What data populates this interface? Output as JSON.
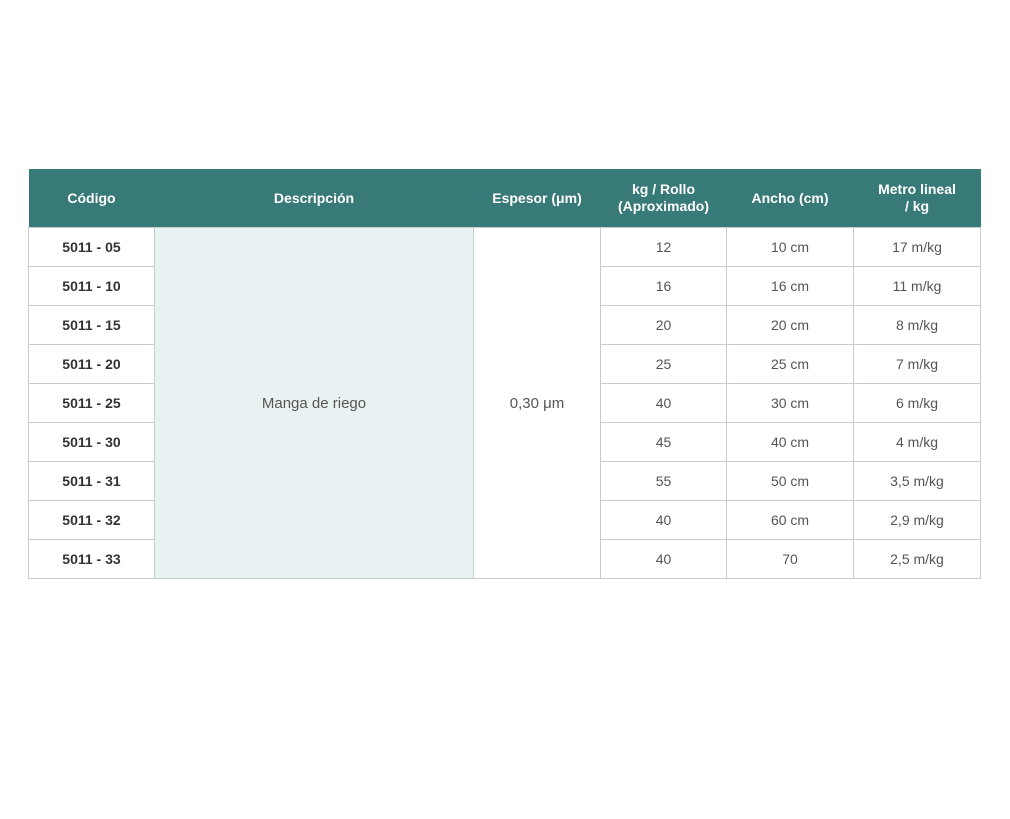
{
  "table": {
    "headers": {
      "code": "Código",
      "description": "Descripción",
      "thickness": "Espesor (μm)",
      "kg_roll_line1": "kg / Rollo",
      "kg_roll_line2": "(Aproximado)",
      "width": "Ancho (cm)",
      "meter_line1": "Metro lineal",
      "meter_line2": "/ kg"
    },
    "description": "Manga de riego",
    "thickness": "0,30 μm",
    "rows": [
      {
        "code": "5011 - 05",
        "kg_roll": "12",
        "width": "10 cm",
        "meter_per_kg": "17 m/kg"
      },
      {
        "code": "5011 - 10",
        "kg_roll": "16",
        "width": "16 cm",
        "meter_per_kg": "11 m/kg"
      },
      {
        "code": "5011 - 15",
        "kg_roll": "20",
        "width": "20 cm",
        "meter_per_kg": "8 m/kg"
      },
      {
        "code": "5011 - 20",
        "kg_roll": "25",
        "width": "25 cm",
        "meter_per_kg": "7 m/kg"
      },
      {
        "code": "5011 - 25",
        "kg_roll": "40",
        "width": "30 cm",
        "meter_per_kg": "6 m/kg"
      },
      {
        "code": "5011 - 30",
        "kg_roll": "45",
        "width": "40 cm",
        "meter_per_kg": "4 m/kg"
      },
      {
        "code": "5011 - 31",
        "kg_roll": "55",
        "width": "50 cm",
        "meter_per_kg": "3,5 m/kg"
      },
      {
        "code": "5011 - 32",
        "kg_roll": "40",
        "width": "60 cm",
        "meter_per_kg": "2,9 m/kg"
      },
      {
        "code": "5011 - 33",
        "kg_roll": "40",
        "width": "70",
        "meter_per_kg": "2,5 m/kg"
      }
    ]
  },
  "colors": {
    "header_background": "#387a78",
    "header_text": "#ffffff",
    "description_background": "#e9f2f3",
    "grid_line": "#c8cccc"
  }
}
